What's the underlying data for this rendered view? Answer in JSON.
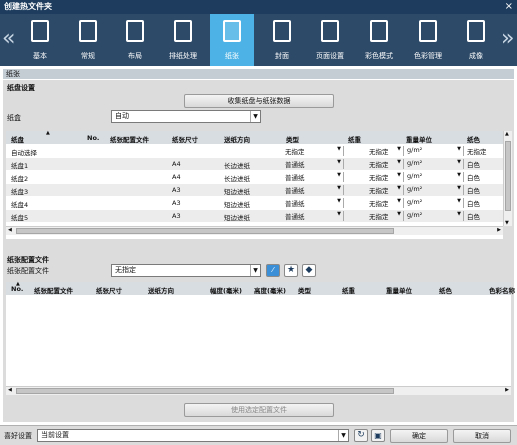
{
  "window": {
    "title": "创建热文件夹",
    "close": "×"
  },
  "nav": {
    "prev": "«",
    "next": "»"
  },
  "tabs": [
    {
      "label": "基本",
      "icon": "basic-icon"
    },
    {
      "label": "常规",
      "icon": "general-icon"
    },
    {
      "label": "布局",
      "icon": "layout-icon"
    },
    {
      "label": "排纸处理",
      "icon": "output-icon"
    },
    {
      "label": "纸张",
      "icon": "paper-icon",
      "active": true
    },
    {
      "label": "封面",
      "icon": "cover-icon"
    },
    {
      "label": "页面设置",
      "icon": "page-setup-icon"
    },
    {
      "label": "彩色模式",
      "icon": "color-mode-icon"
    },
    {
      "label": "色彩管理",
      "icon": "color-management-icon"
    },
    {
      "label": "成像",
      "icon": "imaging-icon"
    }
  ],
  "section": {
    "title": "纸张"
  },
  "tray_settings": {
    "title": "纸盘设置",
    "collect_button": "收集纸盘与纸张数据",
    "tray_label": "纸盒",
    "tray_value": "自动",
    "columns": [
      "纸盘",
      "No.",
      "纸张配置文件",
      "纸张尺寸",
      "送纸方向",
      "类型",
      "纸重",
      "重量单位",
      "纸色"
    ],
    "rows": [
      {
        "tray": "自动选择",
        "no": "",
        "profile": "",
        "size": "",
        "feed": "",
        "type": "无指定",
        "weight": "无指定",
        "unit": "g/m²",
        "color": "无指定"
      },
      {
        "tray": "纸盘1",
        "no": "",
        "profile": "",
        "size": "A4",
        "feed": "长边进纸",
        "type": "普通纸",
        "weight": "无指定",
        "unit": "g/m²",
        "color": "白色"
      },
      {
        "tray": "纸盘2",
        "no": "",
        "profile": "",
        "size": "A4",
        "feed": "长边进纸",
        "type": "普通纸",
        "weight": "无指定",
        "unit": "g/m²",
        "color": "白色"
      },
      {
        "tray": "纸盘3",
        "no": "",
        "profile": "",
        "size": "A3",
        "feed": "短边进纸",
        "type": "普通纸",
        "weight": "无指定",
        "unit": "g/m²",
        "color": "白色"
      },
      {
        "tray": "纸盘4",
        "no": "",
        "profile": "",
        "size": "A3",
        "feed": "短边进纸",
        "type": "普通纸",
        "weight": "无指定",
        "unit": "g/m²",
        "color": "白色"
      },
      {
        "tray": "纸盘5",
        "no": "",
        "profile": "",
        "size": "A3",
        "feed": "短边进纸",
        "type": "普通纸",
        "weight": "无指定",
        "unit": "g/m²",
        "color": "白色"
      }
    ]
  },
  "profile_settings": {
    "title": "纸张配置文件",
    "profile_label": "纸张配置文件",
    "profile_value": "无指定",
    "columns": [
      "No.",
      "纸张配置文件",
      "纸张尺寸",
      "送纸方向",
      "幅度(毫米)",
      "高度(毫米)",
      "类型",
      "纸重",
      "重量单位",
      "纸色",
      "色彩名称"
    ],
    "use_button": "使用选定配置文件"
  },
  "footer": {
    "favorite_label": "喜好设置",
    "favorite_value": "当前设置",
    "ok": "确定",
    "cancel": "取消"
  }
}
